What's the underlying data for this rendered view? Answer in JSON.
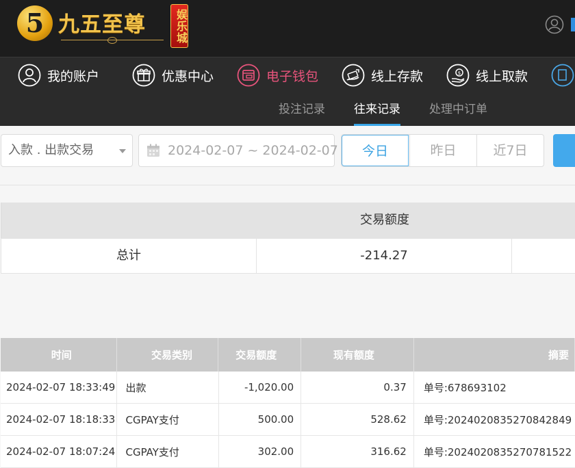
{
  "header": {
    "logo_mark": "5",
    "logo_text": "九五至尊",
    "logo_badge": "娱乐城"
  },
  "nav": {
    "items": [
      {
        "label": "我的账户",
        "icon": "user-icon"
      },
      {
        "label": "优惠中心",
        "icon": "gift-icon"
      },
      {
        "label": "电子钱包",
        "icon": "wallet-icon",
        "active": true
      },
      {
        "label": "线上存款",
        "icon": "deposit-icon"
      },
      {
        "label": "线上取款",
        "icon": "withdraw-icon"
      }
    ]
  },
  "subnav": {
    "tabs": [
      {
        "label": "投注记录"
      },
      {
        "label": "往来记录",
        "active": true
      },
      {
        "label": "处理中订单"
      }
    ]
  },
  "filter": {
    "type_value": "入款 . 出款交易",
    "date_range": "2024-02-07 ~ 2024-02-07",
    "quick": [
      "今日",
      "昨日",
      "近7日"
    ]
  },
  "summary": {
    "header": "交易额度",
    "label": "总计",
    "amount": "-214.27"
  },
  "table": {
    "columns": [
      "时间",
      "交易类别",
      "交易额度",
      "现有额度",
      "摘要"
    ],
    "rows": [
      [
        "2024-02-07 18:33:49",
        "出款",
        "-1,020.00",
        "0.37",
        "单号:678693102"
      ],
      [
        "2024-02-07 18:18:33",
        "CGPAY支付",
        "500.00",
        "528.62",
        "单号:2024020835270842849"
      ],
      [
        "2024-02-07 18:07:24",
        "CGPAY支付",
        "302.00",
        "316.62",
        "单号:2024020835270781522"
      ]
    ]
  },
  "colors": {
    "accent_blue": "#38a6e8",
    "active_pink": "#e9547c",
    "logo_gold": "#f2c34c"
  }
}
